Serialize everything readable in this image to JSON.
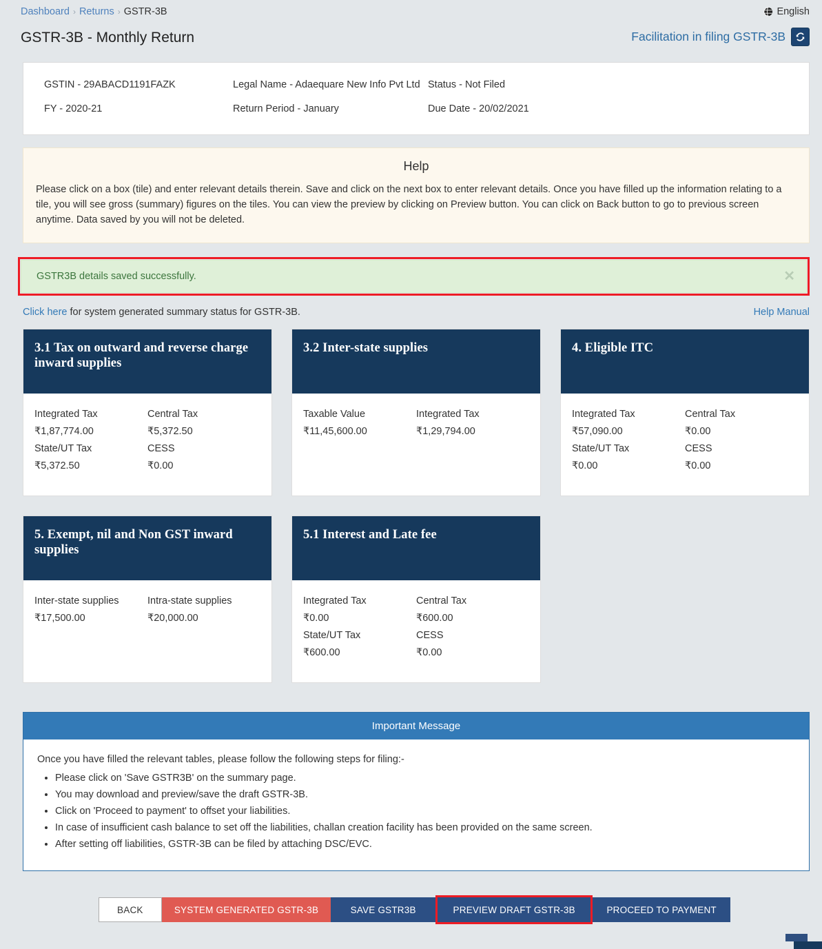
{
  "breadcrumb": {
    "items": [
      {
        "label": "Dashboard",
        "link": true
      },
      {
        "label": "Returns",
        "link": true
      },
      {
        "label": "GSTR-3B",
        "link": false
      }
    ],
    "separator": "›"
  },
  "language": {
    "label": "English",
    "icon": "globe-icon"
  },
  "header": {
    "title": "GSTR-3B - Monthly Return",
    "facilitation_link": "Facilitation in filing GSTR-3B",
    "refresh_icon": "refresh-icon"
  },
  "info_panel": {
    "gstin": "GSTIN - 29ABACD1191FAZK",
    "legal_name": "Legal Name - Adaequare New Info Pvt Ltd",
    "status": "Status - Not Filed",
    "fy": "FY - 2020-21",
    "return_period": "Return Period - January",
    "due_date": "Due Date - 20/02/2021"
  },
  "help": {
    "title": "Help",
    "text": "Please click on a box (tile) and enter relevant details therein. Save and click on the next box to enter relevant details. Once you have filled up the information relating to a tile, you will see gross (summary) figures on the tiles. You can view the preview by clicking on Preview button. You can click on Back button to go to previous screen anytime. Data saved by you will not be deleted."
  },
  "alert": {
    "message": "GSTR3B details saved successfully.",
    "close_icon": "close-icon",
    "background": "#dff0d8",
    "text_color": "#3c763d",
    "highlight_color": "#ee1c25"
  },
  "sublinks": {
    "click_here": "Click here",
    "click_here_rest": " for system generated summary status for GSTR-3B.",
    "help_manual": "Help Manual"
  },
  "tiles": [
    {
      "title": "3.1 Tax on outward and reverse charge inward supplies",
      "cells": [
        {
          "label": "Integrated Tax",
          "value": "₹1,87,774.00"
        },
        {
          "label": "Central Tax",
          "value": "₹5,372.50"
        },
        {
          "label": "State/UT Tax",
          "value": "₹5,372.50"
        },
        {
          "label": "CESS",
          "value": "₹0.00"
        }
      ]
    },
    {
      "title": "3.2 Inter-state supplies",
      "cells": [
        {
          "label": "Taxable Value",
          "value": "₹11,45,600.00"
        },
        {
          "label": "Integrated Tax",
          "value": "₹1,29,794.00"
        }
      ]
    },
    {
      "title": "4. Eligible ITC",
      "cells": [
        {
          "label": "Integrated Tax",
          "value": "₹57,090.00"
        },
        {
          "label": "Central Tax",
          "value": "₹0.00"
        },
        {
          "label": "State/UT Tax",
          "value": "₹0.00"
        },
        {
          "label": "CESS",
          "value": "₹0.00"
        }
      ]
    },
    {
      "title": "5. Exempt, nil and Non GST inward supplies",
      "cells": [
        {
          "label": "Inter-state supplies",
          "value": "₹17,500.00"
        },
        {
          "label": "Intra-state supplies",
          "value": "₹20,000.00"
        }
      ]
    },
    {
      "title": "5.1 Interest and Late fee",
      "cells": [
        {
          "label": "Integrated Tax",
          "value": "₹0.00"
        },
        {
          "label": "Central Tax",
          "value": "₹600.00"
        },
        {
          "label": "State/UT Tax",
          "value": "₹600.00"
        },
        {
          "label": "CESS",
          "value": "₹0.00"
        }
      ]
    }
  ],
  "important_message": {
    "heading": "Important Message",
    "intro": "Once you have filled the relevant tables, please follow the following steps for filing:-",
    "steps": [
      "Please click on 'Save GSTR3B' on the summary page.",
      "You may download and preview/save the draft GSTR-3B.",
      "Click on 'Proceed to payment' to offset your liabilities.",
      "In case of insufficient cash balance to set off the liabilities, challan creation facility has been provided on the same screen.",
      "After setting off liabilities, GSTR-3B can be filed by attaching DSC/EVC."
    ]
  },
  "footer_buttons": {
    "back": "BACK",
    "system_generated": "SYSTEM GENERATED GSTR-3B",
    "save": "SAVE GSTR3B",
    "preview": "PREVIEW DRAFT GSTR-3B",
    "proceed": "PROCEED TO PAYMENT"
  },
  "colors": {
    "page_background": "#e3e7ea",
    "tile_header": "#16395c",
    "primary_blue": "#2c4f84",
    "accent_blue": "#337ab7",
    "danger_red": "#e05a52",
    "highlight_red": "#ee1c25",
    "help_background": "#fdf8ee"
  }
}
